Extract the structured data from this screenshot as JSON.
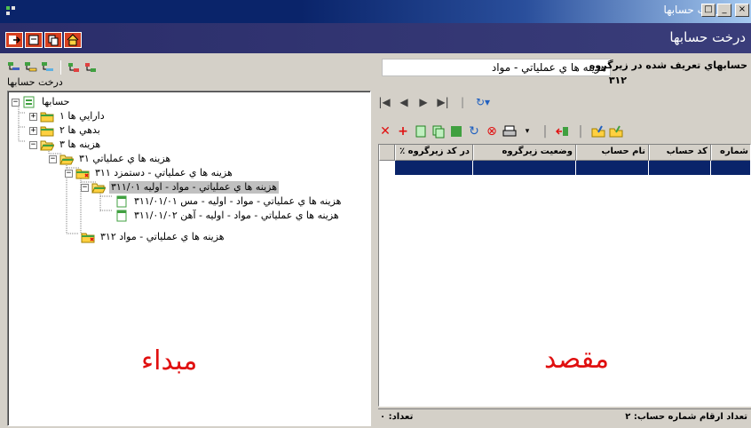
{
  "window": {
    "title": "درخت حسابها"
  },
  "header": {
    "title": "درخت حسابها"
  },
  "left_pane": {
    "caption": "درخت حسابها",
    "tree": [
      {
        "label": "حسابها"
      },
      {
        "label": "دارايي ها ۱"
      },
      {
        "label": "بدهي ها ۲"
      },
      {
        "label": "هزينه ها ۳"
      },
      {
        "label": "هزينه ها ي عملياتي ۳۱"
      },
      {
        "label": "هزينه ها ي عملياتي - دستمزد ۳۱۱"
      },
      {
        "label": "هزينه ها ي عملياتي - مواد - اوليه ۳۱۱/۰۱"
      },
      {
        "label": "هزينه ها ي عملياتي - مواد - اوليه - مس ۳۱۱/۰۱/۰۱"
      },
      {
        "label": "هزينه ها ي عملياتي - مواد - اوليه - آهن ۳۱۱/۰۱/۰۲"
      },
      {
        "label": "هزينه ها ي عملياتي - مواد ۳۱۲"
      }
    ],
    "big_label": "مبداء"
  },
  "right_pane": {
    "caption": "حسابهاي تعريف شده در زيرگروه",
    "subgroup_name": "هزينه ها ي عملياتي - مواد",
    "subgroup_code": "۳۱۲",
    "columns": [
      "شماره",
      "كد حساب",
      "نام حساب",
      "وضعيت زيرگروه",
      "٪ در كد زيرگروه"
    ],
    "big_label": "مقصد",
    "status_left": "تعداد: ۰",
    "status_right": "تعداد ارقام شماره حساب: ۲"
  },
  "colors": {
    "selection": "#0a246a",
    "accent_red": "#e01010",
    "header_bg": "#3a3d7a"
  }
}
